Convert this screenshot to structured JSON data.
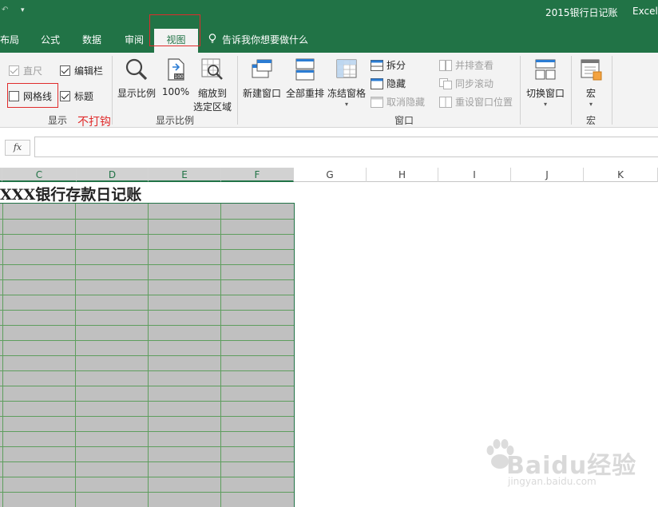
{
  "window": {
    "document_title": "2015银行日记账",
    "app_name": "Excel",
    "undo_glyph": "↶",
    "qat_dropdown_glyph": "▾"
  },
  "tabs": {
    "page_layout": "布局",
    "formulas": "公式",
    "data": "数据",
    "review": "审阅",
    "view": "视图",
    "tell_me": "告诉我你想要做什么"
  },
  "ribbon": {
    "show_group": {
      "label": "显示",
      "ruler": {
        "label": "直尺",
        "checked": true,
        "enabled": false
      },
      "formula_bar": {
        "label": "编辑栏",
        "checked": true,
        "enabled": true
      },
      "gridlines": {
        "label": "网格线",
        "checked": false,
        "enabled": true
      },
      "headings": {
        "label": "标题",
        "checked": true,
        "enabled": true
      },
      "annotation": "不打钩"
    },
    "zoom_group": {
      "label": "显示比例",
      "zoom": "显示比例",
      "zoom_100": "100%",
      "zoom_to_selection_line1": "缩放到",
      "zoom_to_selection_line2": "选定区域",
      "zoom_100_icon_text": "100"
    },
    "window_group": {
      "label": "窗口",
      "new_window": "新建窗口",
      "arrange_all": "全部重排",
      "freeze_panes": "冻结窗格",
      "split": "拆分",
      "hide": "隐藏",
      "unhide": "取消隐藏",
      "view_side_by_side": "并排查看",
      "synchronous_scrolling": "同步滚动",
      "reset_window_position": "重设窗口位置",
      "switch_windows": "切换窗口"
    },
    "macros_group": {
      "label": "宏",
      "macros": "宏"
    },
    "caret": "▾"
  },
  "formula_bar": {
    "fx_label": "fx",
    "value": ""
  },
  "columns": [
    "C",
    "D",
    "E",
    "F",
    "G",
    "H",
    "I",
    "J",
    "K"
  ],
  "selected_columns": [
    "C",
    "D",
    "E",
    "F"
  ],
  "sheet": {
    "title": "XXX银行存款日记账"
  },
  "watermark": {
    "brand": "Baidu经验",
    "url": "jingyan.baidu.com"
  },
  "colors": {
    "excel_green": "#217346",
    "highlight_red": "#e02b2b",
    "cell_fill": "#c0c0c0"
  }
}
